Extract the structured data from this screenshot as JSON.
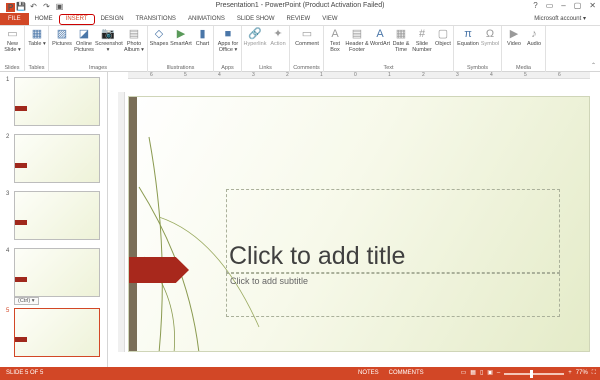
{
  "titlebar": {
    "title": "Presentation1 - PowerPoint (Product Activation Failed)",
    "controls": [
      "?",
      "▭",
      "–",
      "▢",
      "✕"
    ]
  },
  "tabs": [
    "FILE",
    "HOME",
    "INSERT",
    "DESIGN",
    "TRANSITIONS",
    "ANIMATIONS",
    "SLIDE SHOW",
    "REVIEW",
    "VIEW"
  ],
  "active_tab": "INSERT",
  "account": "Microsoft account ▾",
  "ribbon": {
    "groups": [
      {
        "label": "Slides",
        "commands": [
          {
            "label": "New Slide ▾",
            "icon": "new-slide-icon"
          }
        ]
      },
      {
        "label": "Tables",
        "commands": [
          {
            "label": "Table ▾",
            "icon": "table-icon"
          }
        ]
      },
      {
        "label": "Images",
        "commands": [
          {
            "label": "Pictures",
            "icon": "pictures-icon"
          },
          {
            "label": "Online Pictures",
            "icon": "online-pictures-icon"
          },
          {
            "label": "Screenshot ▾",
            "icon": "screenshot-icon"
          },
          {
            "label": "Photo Album ▾",
            "icon": "photo-album-icon"
          }
        ]
      },
      {
        "label": "Illustrations",
        "commands": [
          {
            "label": "Shapes",
            "icon": "shapes-icon"
          },
          {
            "label": "SmartArt",
            "icon": "smartart-icon"
          },
          {
            "label": "Chart",
            "icon": "chart-icon"
          }
        ]
      },
      {
        "label": "Apps",
        "commands": [
          {
            "label": "Apps for Office ▾",
            "icon": "apps-icon"
          }
        ]
      },
      {
        "label": "Links",
        "commands": [
          {
            "label": "Hyperlink",
            "icon": "hyperlink-icon"
          },
          {
            "label": "Action",
            "icon": "action-icon"
          }
        ]
      },
      {
        "label": "Comments",
        "commands": [
          {
            "label": "Comment",
            "icon": "comment-icon"
          }
        ]
      },
      {
        "label": "Text",
        "commands": [
          {
            "label": "Text Box",
            "icon": "text-box-icon"
          },
          {
            "label": "Header & Footer",
            "icon": "header-footer-icon"
          },
          {
            "label": "WordArt",
            "icon": "wordart-icon"
          },
          {
            "label": "Date & Time",
            "icon": "date-time-icon"
          },
          {
            "label": "Slide Number",
            "icon": "slide-number-icon"
          },
          {
            "label": "Object",
            "icon": "object-icon"
          }
        ]
      },
      {
        "label": "Symbols",
        "commands": [
          {
            "label": "Equation",
            "icon": "equation-icon"
          },
          {
            "label": "Symbol",
            "icon": "symbol-icon"
          }
        ]
      },
      {
        "label": "Media",
        "commands": [
          {
            "label": "Video",
            "icon": "video-icon"
          },
          {
            "label": "Audio",
            "icon": "audio-icon"
          }
        ]
      }
    ]
  },
  "ruler": {
    "ticks": [
      "6",
      "5",
      "4",
      "3",
      "2",
      "1",
      "0",
      "1",
      "2",
      "3",
      "4",
      "5",
      "6"
    ]
  },
  "thumbnails": [
    {
      "number": "1"
    },
    {
      "number": "2"
    },
    {
      "number": "3"
    },
    {
      "number": "4"
    },
    {
      "number": "5"
    }
  ],
  "ctrl_badge": "(Ctrl) ▾",
  "slide": {
    "title_placeholder": "Click to add title",
    "subtitle_placeholder": "Click to add subtitle"
  },
  "status": {
    "slide_info": "SLIDE 5 OF 5",
    "notes": "NOTES",
    "comments": "COMMENTS",
    "zoom_minus": "–",
    "zoom_plus": "+",
    "zoom": "77%"
  },
  "colors": {
    "accent": "#d24726",
    "slide_arrow": "#a8281c",
    "highlight_border": "#cc0000"
  }
}
